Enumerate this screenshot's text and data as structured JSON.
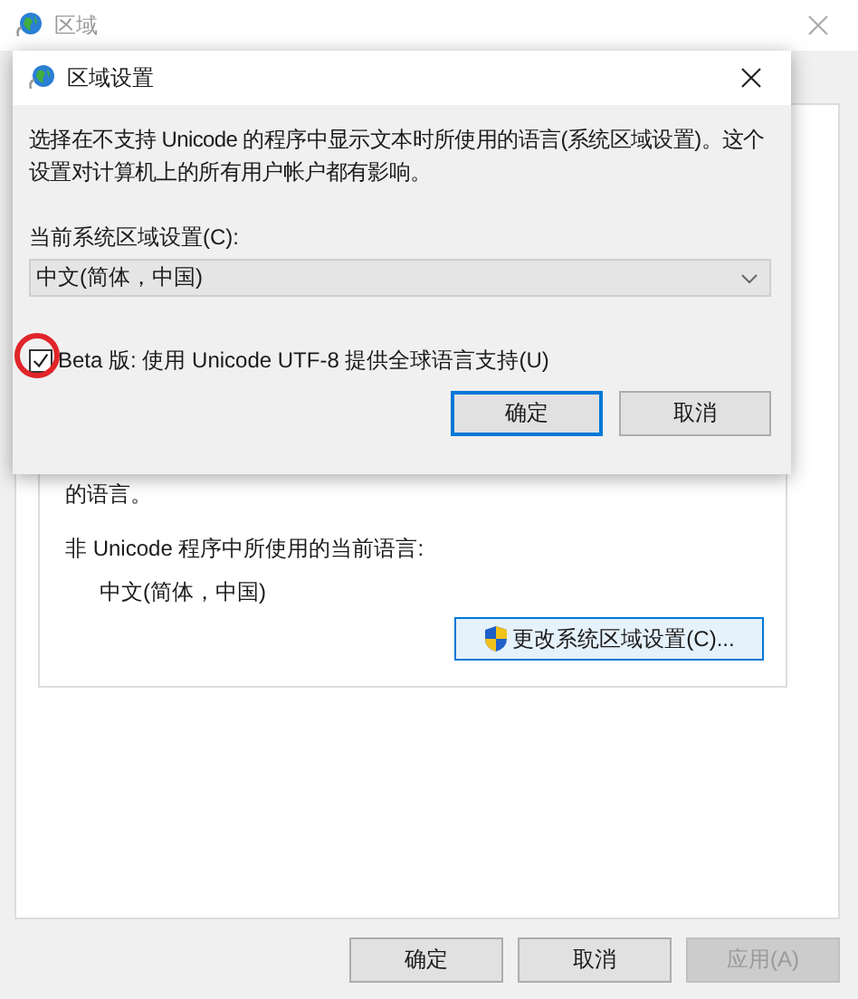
{
  "window": {
    "title": "区域"
  },
  "group": {
    "text_above": "的语言。",
    "label": "非 Unicode 程序中所使用的当前语言:",
    "current_language": "中文(简体，中国)",
    "change_button": "更改系统区域设置(C)..."
  },
  "buttons": [
    {
      "label": "确定",
      "disabled": false
    },
    {
      "label": "取消",
      "disabled": false
    },
    {
      "label": "应用(A)",
      "disabled": true
    }
  ],
  "dialog": {
    "title": "区域设置",
    "description": "选择在不支持 Unicode 的程序中显示文本时所使用的语言(系统区域设置)。这个设置对计算机上的所有用户帐户都有影响。",
    "locale_label": "当前系统区域设置(C):",
    "locale_value": "中文(简体，中国)",
    "checkbox": {
      "label": "Beta 版: 使用 Unicode UTF-8 提供全球语言支持(U)",
      "checked": true,
      "highlighted": true
    },
    "buttons": [
      {
        "label": "确定",
        "default": true
      },
      {
        "label": "取消",
        "default": false
      }
    ]
  }
}
